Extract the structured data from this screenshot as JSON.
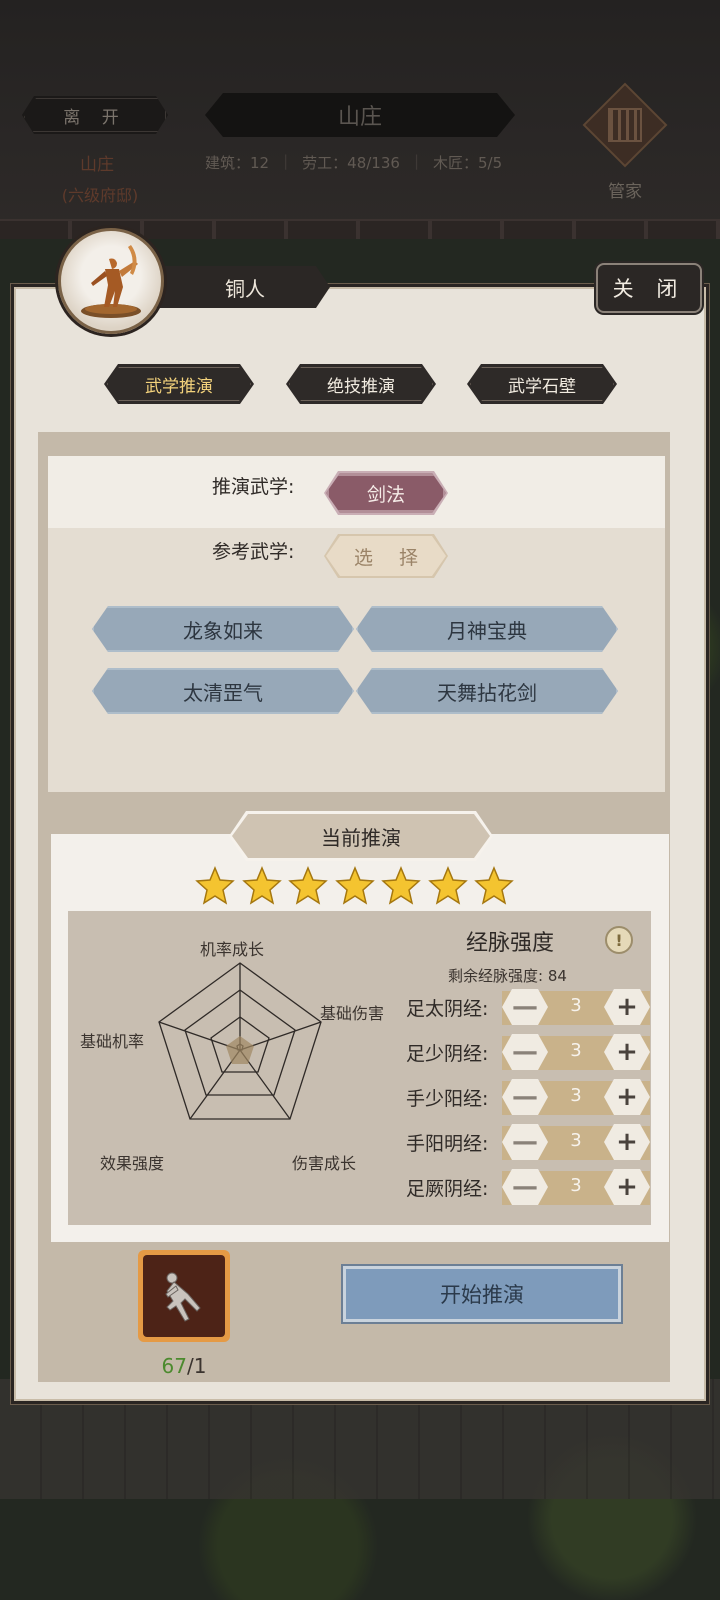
{
  "header": {
    "leave_label": "离 开",
    "estate_name": "山庄",
    "estate_rank": "(六级府邸)",
    "title": "山庄",
    "stats": {
      "buildings": "建筑：12",
      "laborers": "劳工：48/136",
      "carpenters": "木匠：5/5"
    },
    "butler_label": "管家"
  },
  "panel": {
    "character_name": "铜人",
    "close_label": "关 闭",
    "tabs": [
      {
        "label": "武学推演",
        "active": true
      },
      {
        "label": "绝技推演",
        "active": false
      },
      {
        "label": "武学石壁",
        "active": false
      }
    ],
    "deduce": {
      "deduce_label": "推演武学:",
      "deduce_value": "剑法",
      "reference_label": "参考武学:",
      "select_label": "选 择",
      "skills": [
        "龙象如来",
        "月神宝典",
        "太清罡气",
        "天舞拈花剑"
      ]
    },
    "current": {
      "title": "当前推演",
      "stars": 7,
      "radar_labels": {
        "top": "机率成长",
        "right": "基础伤害",
        "bottom_right": "伤害成长",
        "bottom_left": "效果强度",
        "left": "基础机率"
      },
      "meridian": {
        "title": "经脉强度",
        "info_icon": "!",
        "remaining": "剩余经脉强度:  84",
        "rows": [
          {
            "label": "足太阴经:",
            "value": "3"
          },
          {
            "label": "足少阴经:",
            "value": "3"
          },
          {
            "label": "手少阳经:",
            "value": "3"
          },
          {
            "label": "手阳明经:",
            "value": "3"
          },
          {
            "label": "足厥阴经:",
            "value": "3"
          }
        ]
      }
    },
    "item": {
      "have": "67",
      "need": "/1"
    },
    "start_label": "开始推演"
  },
  "colors": {
    "active_tab_text": "#f3d27c",
    "sword_chip": "#8a5b68",
    "skill_button": "#97a8b8",
    "start_button": "#7e9bbb",
    "star": "#f4c430",
    "item_have": "#4c8a2e"
  }
}
